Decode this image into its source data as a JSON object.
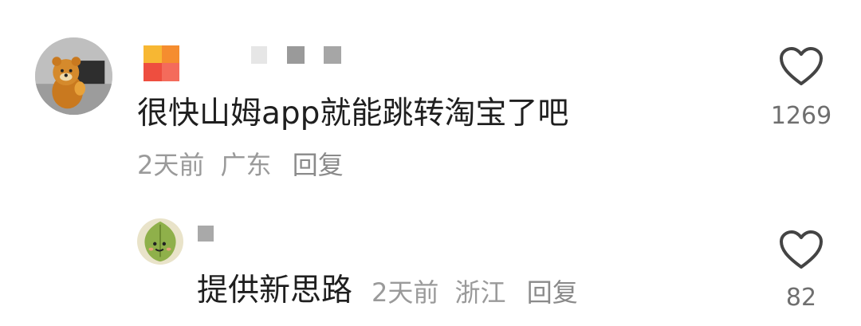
{
  "comments": [
    {
      "text": "很快山姆app就能跳转淘宝了吧",
      "time": "2天前",
      "location": "广东",
      "reply_label": "回复",
      "like_count": "1269",
      "like_icon": "heart-outline-icon"
    },
    {
      "text": "提供新思路",
      "time": "2天前",
      "location": "浙江",
      "reply_label": "回复",
      "like_count": "82",
      "like_icon": "heart-outline-icon"
    }
  ],
  "colors": {
    "text": "#1f1f1f",
    "meta": "#9a9a9a",
    "like_count": "#6f6f6f",
    "heart": "#444444"
  }
}
